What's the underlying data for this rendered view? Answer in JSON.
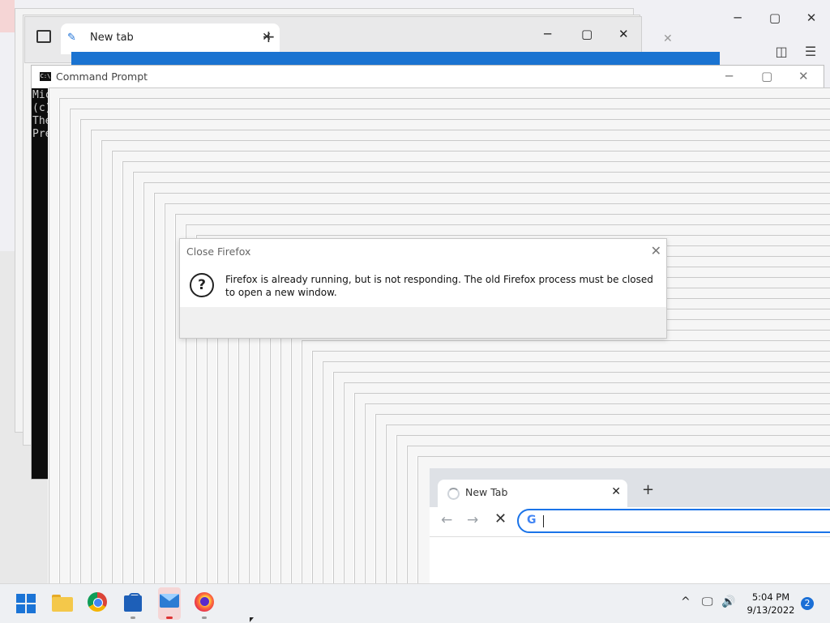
{
  "firefox_back": {
    "minimize": "─",
    "maximize": "▢",
    "close": "✕",
    "pocket_icon": "pocket-icon",
    "menu_icon": "hamburger-icon"
  },
  "edge": {
    "tab_label": "New tab",
    "tab_close": "✕",
    "new_tab": "+",
    "minimize": "─",
    "maximize": "▢",
    "close": "✕"
  },
  "cmd": {
    "title": "Command Prompt",
    "icon_text": "C:\\",
    "minimize": "─",
    "maximize": "▢",
    "close": "✕",
    "lines": [
      "Mic",
      "(c)",
      "",
      "The",
      "",
      "Pre"
    ]
  },
  "dialog": {
    "title": "Close Firefox",
    "close": "✕",
    "icon": "?",
    "message": "Firefox is already running, but is not responding. The old Firefox process must be closed to open a new window."
  },
  "chrome": {
    "tab_label": "New Tab",
    "tab_close": "✕",
    "new_tab": "+",
    "back": "←",
    "forward": "→",
    "stop": "✕",
    "google_g": "G"
  },
  "taskbar": {
    "apps": [
      "start",
      "file-explorer",
      "chrome",
      "microsoft-store",
      "mail",
      "firefox"
    ],
    "tray_chevron": "^",
    "time": "5:04 PM",
    "date": "9/13/2022",
    "notification_count": "2"
  }
}
